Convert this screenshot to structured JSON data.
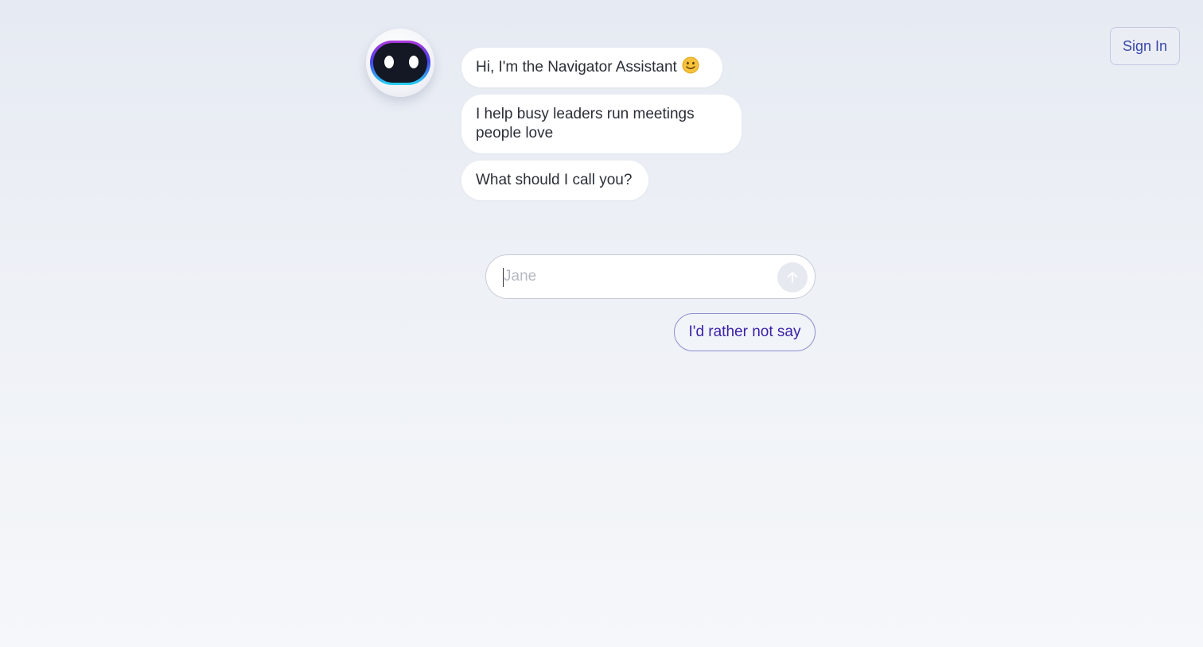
{
  "header": {
    "signin_label": "Sign In"
  },
  "assistant": {
    "avatar_icon": "robot-avatar-icon",
    "messages": [
      "Hi, I'm the Navigator Assistant",
      "I help busy leaders run meetings people love",
      "What should I call you?"
    ],
    "greeting_emoji": "🙂"
  },
  "name_input": {
    "placeholder": "Jane",
    "value": "",
    "send_icon": "arrow-up-icon"
  },
  "quick_reply": {
    "label": "I'd rather not say"
  },
  "colors": {
    "accent": "#3a1fa8",
    "signin_text": "#3848a8",
    "bubble_bg": "#ffffff"
  }
}
